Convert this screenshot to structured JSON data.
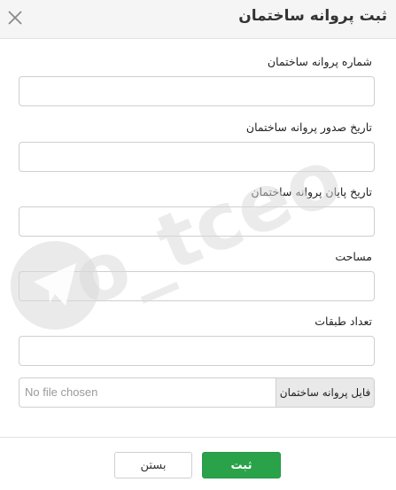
{
  "modal": {
    "title": "ثبت پروانه ساختمان",
    "close_icon": "close-icon"
  },
  "fields": [
    {
      "label": "شماره پروانه ساختمان",
      "value": ""
    },
    {
      "label": "تاریخ صدور پروانه ساختمان",
      "value": ""
    },
    {
      "label": "تاریخ پایان پروانه ساختمان",
      "value": ""
    },
    {
      "label": "مساحت",
      "value": ""
    },
    {
      "label": "تعداد طبقات",
      "value": ""
    }
  ],
  "file_upload": {
    "button_label": "فایل پروانه ساختمان",
    "status": "No file chosen"
  },
  "footer": {
    "submit_label": "ثبت",
    "close_label": "بستن"
  },
  "watermark": {
    "text": "o_tceo",
    "icon": "telegram-icon"
  },
  "colors": {
    "header_bg": "#f5f5f5",
    "submit_bg": "#2aa24a",
    "border": "#cfcfcf",
    "watermark": "#d9d9d9"
  }
}
